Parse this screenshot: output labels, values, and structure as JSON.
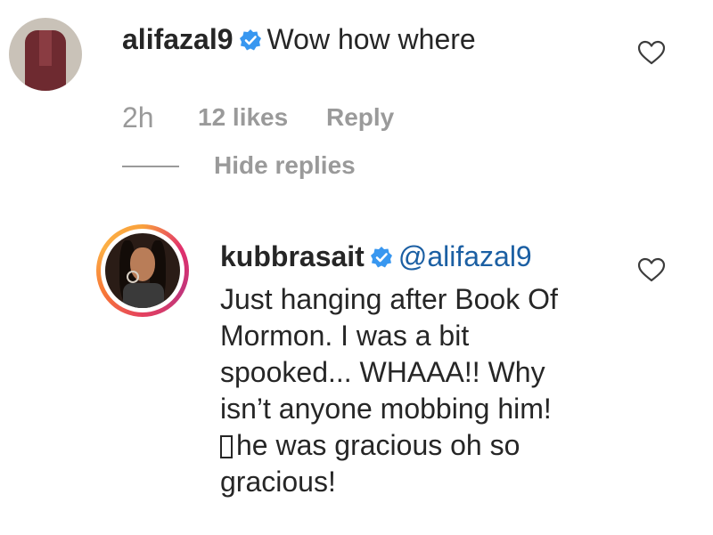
{
  "comment": {
    "username": "alifazal9",
    "text": "Wow how where",
    "time": "2h",
    "likes": "12 likes",
    "reply_label": "Reply",
    "heart_icon": "heart-outline-icon",
    "verified_icon": "verified-badge-icon"
  },
  "replies_toggle": {
    "label": "Hide replies"
  },
  "reply": {
    "username": "kubbrasait",
    "mention": "@alifazal9",
    "lines": [
      "Just hanging after Book Of",
      "Mormon. I was a bit",
      "spooked... WHAAA!! Why",
      "isn’t anyone mobbing him!",
      "he was gracious oh so",
      "gracious!"
    ],
    "heart_icon": "heart-outline-icon",
    "verified_icon": "verified-badge-icon"
  },
  "colors": {
    "text": "#262626",
    "meta": "#9a9a9a",
    "mention": "#1b5fa3",
    "verified": "#3897f0"
  }
}
